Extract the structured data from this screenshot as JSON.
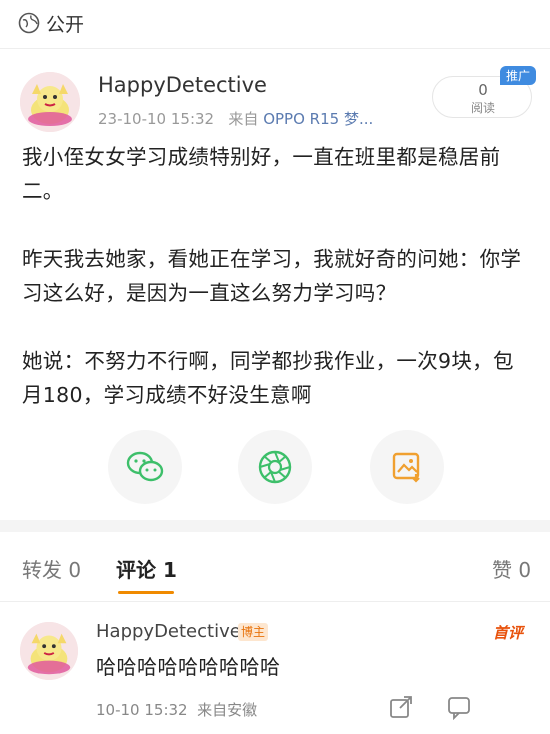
{
  "header": {
    "visibility_label": "公开"
  },
  "post": {
    "author": "HappyDetective",
    "time": "23-10-10 15:32",
    "from_label": "来自",
    "device": "OPPO R15 梦...",
    "read_count": "0",
    "read_label": "阅读",
    "promo_tag": "推广",
    "paragraphs": [
      "我小侄女女学习成绩特别好，一直在班里都是稳居前二。",
      "昨天我去她家，看她正在学习，我就好奇的问她：你学习这么好，是因为一直这么努力学习吗？",
      "她说：不努力不行啊，同学都抄我作业，一次9块，包月180，学习成绩不好没生意啊"
    ]
  },
  "share": {
    "icons": [
      "wechat-icon",
      "moments-icon",
      "save-image-icon"
    ],
    "colors": {
      "wechat": "#3dbf6a",
      "image": "#f0a030"
    }
  },
  "tabs": {
    "repost": "转发 0",
    "comments": "评论 1",
    "likes": "赞 0",
    "active_color": "#f08a00"
  },
  "comment": {
    "author": "HappyDetective",
    "badge": "博主",
    "top_label": "首评",
    "text": "哈哈哈哈哈哈哈哈哈",
    "time": "10-10 15:32",
    "source": "来自安徽"
  }
}
